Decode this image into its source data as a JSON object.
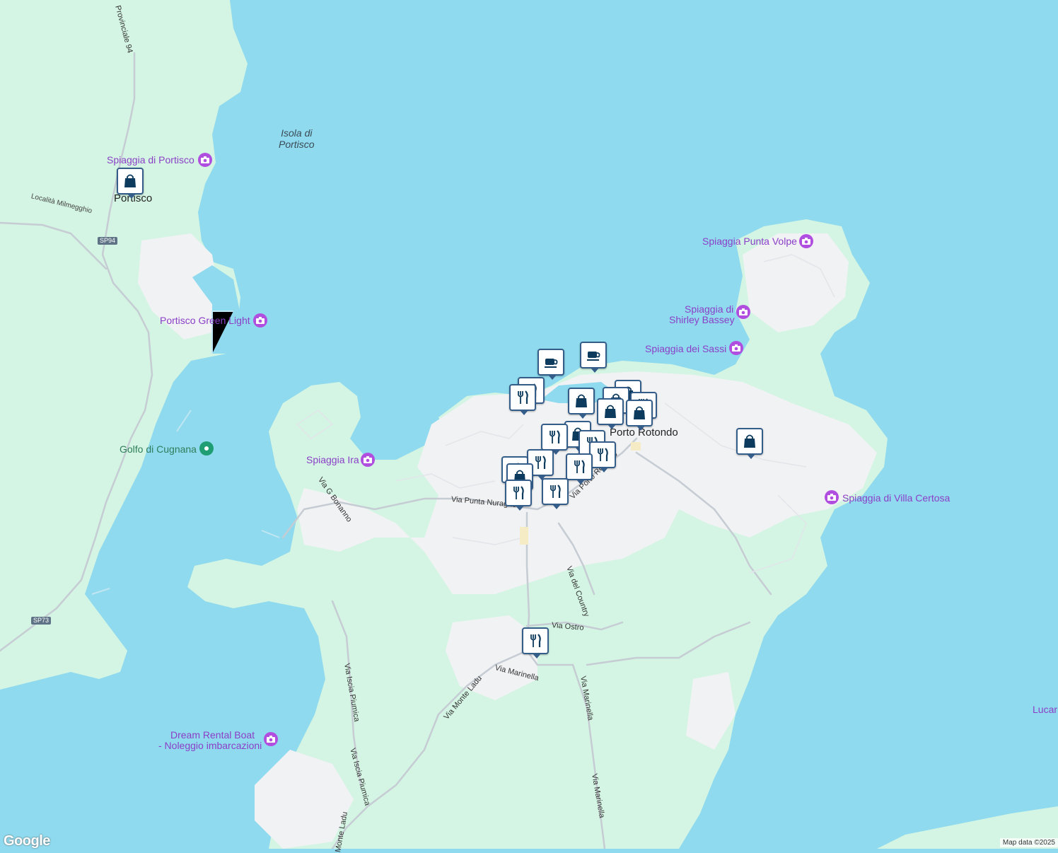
{
  "map": {
    "colors": {
      "water": "#8fdaee",
      "land": "#d4f5e3",
      "urban": "#f1f2f4",
      "road": "#c6ccd3",
      "major_road": "#b9c0c8",
      "poi": "#b04ee0",
      "pin": "#355d8a"
    }
  },
  "places": {
    "portisco": "Portisco",
    "porto_rotondo": "Porto Rotondo",
    "isola": "Isola di\nPortisco"
  },
  "pois": {
    "spiaggia_portisco": "Spiaggia di Portisco",
    "portisco_green": "Portisco Green Light",
    "golfo": "Golfo di Cugnana",
    "spiaggia_ira": "Spiaggia Ira",
    "punta_volpe": "Spiaggia Punta Volpe",
    "shirley_1": "Spiaggia di",
    "shirley_2": "Shirley Bassey",
    "sassi": "Spiaggia dei Sassi",
    "villa_certosa": "Spiaggia di Villa Certosa",
    "dream_1": "Dream Rental Boat",
    "dream_2": "- Noleggio imbarcazioni",
    "lucar": "Lucar"
  },
  "roads": {
    "provinciale": "Provinciale 94",
    "milmegghio": "Località Milmegghio",
    "sp94": "SP94",
    "sp73": "SP73",
    "bonanno": "Via G Bonanno",
    "punta_nuraghe": "Via Punta Nuraghe",
    "porto_rotondo": "Via Porto Rotondo",
    "country": "Via del Country",
    "ostro": "Via Ostro",
    "marinella_1": "Via Marinella",
    "marinella_2": "Via Marinella",
    "marinella_3": "Via Marinella",
    "monte_ladu_1": "Via Monte Ladu",
    "monte_ladu_2": "Monte Ladu",
    "iscia_1": "Via Iscia Piumica",
    "iscia_2": "Via Iscia Piumica"
  },
  "footer": {
    "logo": "Google",
    "attribution": "Map data ©2025"
  },
  "icons": {
    "shopping": "shopping-bag-icon",
    "restaurant": "fork-knife-icon",
    "cafe": "coffee-cup-icon",
    "attraction": "camera-icon",
    "park": "tree-icon"
  }
}
